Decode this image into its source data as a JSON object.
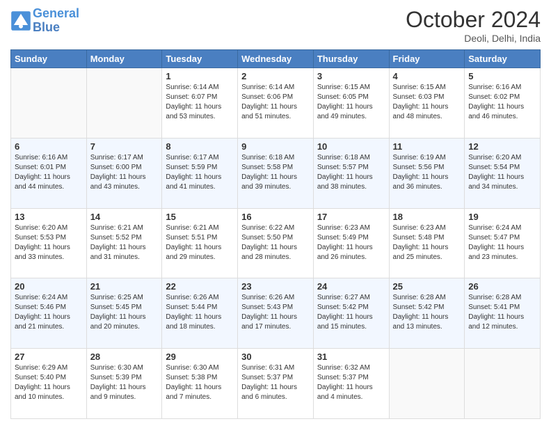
{
  "header": {
    "logo_line1": "General",
    "logo_line2": "Blue",
    "month": "October 2024",
    "location": "Deoli, Delhi, India"
  },
  "weekdays": [
    "Sunday",
    "Monday",
    "Tuesday",
    "Wednesday",
    "Thursday",
    "Friday",
    "Saturday"
  ],
  "weeks": [
    [
      {
        "day": "",
        "sunrise": "",
        "sunset": "",
        "daylight": ""
      },
      {
        "day": "",
        "sunrise": "",
        "sunset": "",
        "daylight": ""
      },
      {
        "day": "1",
        "sunrise": "Sunrise: 6:14 AM",
        "sunset": "Sunset: 6:07 PM",
        "daylight": "Daylight: 11 hours and 53 minutes."
      },
      {
        "day": "2",
        "sunrise": "Sunrise: 6:14 AM",
        "sunset": "Sunset: 6:06 PM",
        "daylight": "Daylight: 11 hours and 51 minutes."
      },
      {
        "day": "3",
        "sunrise": "Sunrise: 6:15 AM",
        "sunset": "Sunset: 6:05 PM",
        "daylight": "Daylight: 11 hours and 49 minutes."
      },
      {
        "day": "4",
        "sunrise": "Sunrise: 6:15 AM",
        "sunset": "Sunset: 6:03 PM",
        "daylight": "Daylight: 11 hours and 48 minutes."
      },
      {
        "day": "5",
        "sunrise": "Sunrise: 6:16 AM",
        "sunset": "Sunset: 6:02 PM",
        "daylight": "Daylight: 11 hours and 46 minutes."
      }
    ],
    [
      {
        "day": "6",
        "sunrise": "Sunrise: 6:16 AM",
        "sunset": "Sunset: 6:01 PM",
        "daylight": "Daylight: 11 hours and 44 minutes."
      },
      {
        "day": "7",
        "sunrise": "Sunrise: 6:17 AM",
        "sunset": "Sunset: 6:00 PM",
        "daylight": "Daylight: 11 hours and 43 minutes."
      },
      {
        "day": "8",
        "sunrise": "Sunrise: 6:17 AM",
        "sunset": "Sunset: 5:59 PM",
        "daylight": "Daylight: 11 hours and 41 minutes."
      },
      {
        "day": "9",
        "sunrise": "Sunrise: 6:18 AM",
        "sunset": "Sunset: 5:58 PM",
        "daylight": "Daylight: 11 hours and 39 minutes."
      },
      {
        "day": "10",
        "sunrise": "Sunrise: 6:18 AM",
        "sunset": "Sunset: 5:57 PM",
        "daylight": "Daylight: 11 hours and 38 minutes."
      },
      {
        "day": "11",
        "sunrise": "Sunrise: 6:19 AM",
        "sunset": "Sunset: 5:56 PM",
        "daylight": "Daylight: 11 hours and 36 minutes."
      },
      {
        "day": "12",
        "sunrise": "Sunrise: 6:20 AM",
        "sunset": "Sunset: 5:54 PM",
        "daylight": "Daylight: 11 hours and 34 minutes."
      }
    ],
    [
      {
        "day": "13",
        "sunrise": "Sunrise: 6:20 AM",
        "sunset": "Sunset: 5:53 PM",
        "daylight": "Daylight: 11 hours and 33 minutes."
      },
      {
        "day": "14",
        "sunrise": "Sunrise: 6:21 AM",
        "sunset": "Sunset: 5:52 PM",
        "daylight": "Daylight: 11 hours and 31 minutes."
      },
      {
        "day": "15",
        "sunrise": "Sunrise: 6:21 AM",
        "sunset": "Sunset: 5:51 PM",
        "daylight": "Daylight: 11 hours and 29 minutes."
      },
      {
        "day": "16",
        "sunrise": "Sunrise: 6:22 AM",
        "sunset": "Sunset: 5:50 PM",
        "daylight": "Daylight: 11 hours and 28 minutes."
      },
      {
        "day": "17",
        "sunrise": "Sunrise: 6:23 AM",
        "sunset": "Sunset: 5:49 PM",
        "daylight": "Daylight: 11 hours and 26 minutes."
      },
      {
        "day": "18",
        "sunrise": "Sunrise: 6:23 AM",
        "sunset": "Sunset: 5:48 PM",
        "daylight": "Daylight: 11 hours and 25 minutes."
      },
      {
        "day": "19",
        "sunrise": "Sunrise: 6:24 AM",
        "sunset": "Sunset: 5:47 PM",
        "daylight": "Daylight: 11 hours and 23 minutes."
      }
    ],
    [
      {
        "day": "20",
        "sunrise": "Sunrise: 6:24 AM",
        "sunset": "Sunset: 5:46 PM",
        "daylight": "Daylight: 11 hours and 21 minutes."
      },
      {
        "day": "21",
        "sunrise": "Sunrise: 6:25 AM",
        "sunset": "Sunset: 5:45 PM",
        "daylight": "Daylight: 11 hours and 20 minutes."
      },
      {
        "day": "22",
        "sunrise": "Sunrise: 6:26 AM",
        "sunset": "Sunset: 5:44 PM",
        "daylight": "Daylight: 11 hours and 18 minutes."
      },
      {
        "day": "23",
        "sunrise": "Sunrise: 6:26 AM",
        "sunset": "Sunset: 5:43 PM",
        "daylight": "Daylight: 11 hours and 17 minutes."
      },
      {
        "day": "24",
        "sunrise": "Sunrise: 6:27 AM",
        "sunset": "Sunset: 5:42 PM",
        "daylight": "Daylight: 11 hours and 15 minutes."
      },
      {
        "day": "25",
        "sunrise": "Sunrise: 6:28 AM",
        "sunset": "Sunset: 5:42 PM",
        "daylight": "Daylight: 11 hours and 13 minutes."
      },
      {
        "day": "26",
        "sunrise": "Sunrise: 6:28 AM",
        "sunset": "Sunset: 5:41 PM",
        "daylight": "Daylight: 11 hours and 12 minutes."
      }
    ],
    [
      {
        "day": "27",
        "sunrise": "Sunrise: 6:29 AM",
        "sunset": "Sunset: 5:40 PM",
        "daylight": "Daylight: 11 hours and 10 minutes."
      },
      {
        "day": "28",
        "sunrise": "Sunrise: 6:30 AM",
        "sunset": "Sunset: 5:39 PM",
        "daylight": "Daylight: 11 hours and 9 minutes."
      },
      {
        "day": "29",
        "sunrise": "Sunrise: 6:30 AM",
        "sunset": "Sunset: 5:38 PM",
        "daylight": "Daylight: 11 hours and 7 minutes."
      },
      {
        "day": "30",
        "sunrise": "Sunrise: 6:31 AM",
        "sunset": "Sunset: 5:37 PM",
        "daylight": "Daylight: 11 hours and 6 minutes."
      },
      {
        "day": "31",
        "sunrise": "Sunrise: 6:32 AM",
        "sunset": "Sunset: 5:37 PM",
        "daylight": "Daylight: 11 hours and 4 minutes."
      },
      {
        "day": "",
        "sunrise": "",
        "sunset": "",
        "daylight": ""
      },
      {
        "day": "",
        "sunrise": "",
        "sunset": "",
        "daylight": ""
      }
    ]
  ]
}
